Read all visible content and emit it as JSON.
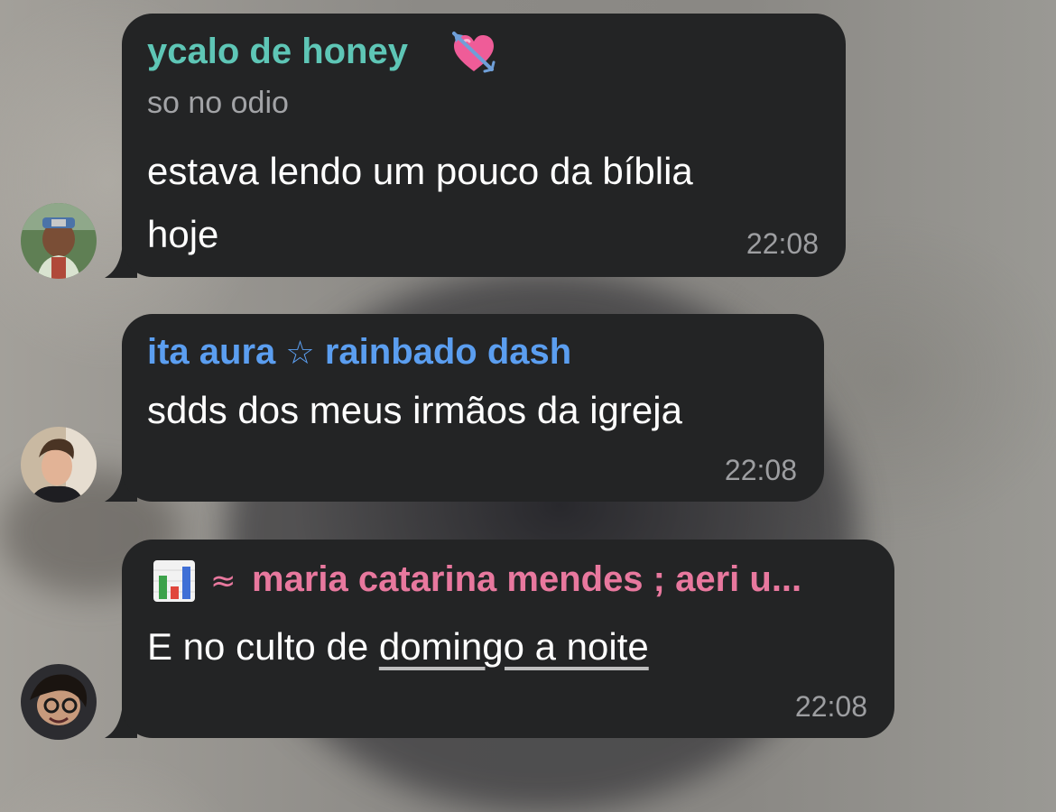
{
  "messages": [
    {
      "sender": "ycalo de honey",
      "sender_color": "#5ec6b6",
      "sender_emoji": "heart-with-arrow-icon",
      "subtitle": "so no odio",
      "text_line1": "estava lendo um pouco da bíblia",
      "text_line2": "hoje",
      "time": "22:08"
    },
    {
      "sender_part1": "ita aura",
      "star": "☆",
      "sender_part2": "rainbado dash",
      "sender_color": "#5b9ef0",
      "text": "sdds dos meus irmãos da igreja",
      "time": "22:08"
    },
    {
      "sender_icon": "bar-chart-icon",
      "approx": "≈",
      "sender": "maria catarina mendes ; aeri u...",
      "sender_color": "#e8789e",
      "text_prefix": "E no culto de ",
      "text_link": "domingo a noite",
      "time": "22:08"
    }
  ],
  "colors": {
    "bubble": "#232425",
    "timestamp": "#9d9ea1"
  }
}
